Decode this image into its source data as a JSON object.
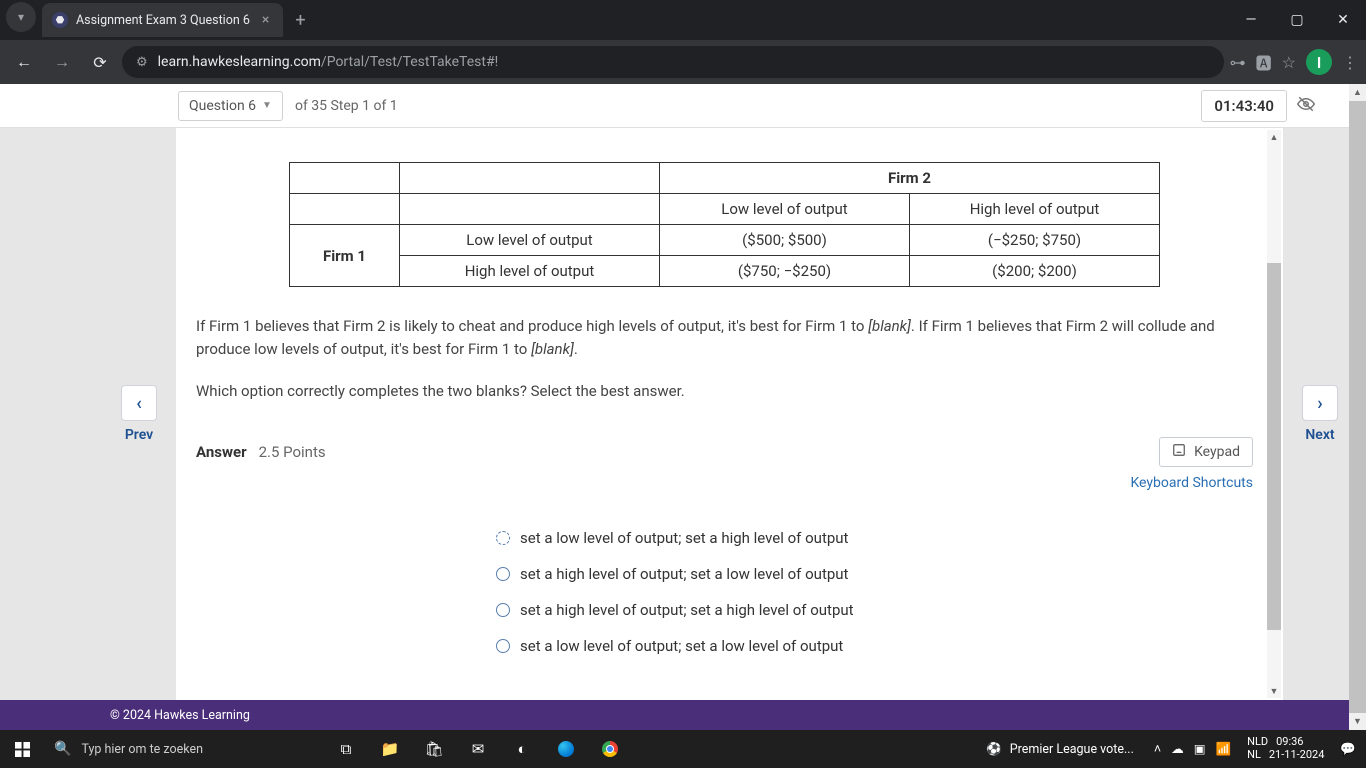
{
  "browser": {
    "tab_title": "Assignment Exam 3 Question 6",
    "url_host": "learn.hawkeslearning.com",
    "url_path": "/Portal/Test/TestTakeTest#!"
  },
  "header": {
    "question_label": "Question 6",
    "step_label": "of 35 Step 1 of 1",
    "timer": "01:43:40"
  },
  "nav": {
    "prev": "Prev",
    "next": "Next"
  },
  "table": {
    "firm2_header": "Firm 2",
    "col_low": "Low level of output",
    "col_high": "High level of output",
    "firm1_header": "Firm 1",
    "row_low": "Low level of output",
    "row_high": "High level of output",
    "cells": {
      "ll": "($500; $500)",
      "lh": "(−$250; $750)",
      "hl": "($750; −$250)",
      "hh": "($200; $200)"
    }
  },
  "question": {
    "p1a": "If Firm 1 believes that Firm 2 is likely to cheat and produce high levels of output, it's best for Firm 1 to ",
    "blank": "[blank]",
    "p1b": ". If Firm 1 believes that Firm 2 will collude and produce low levels of output, it's best for Firm 1 to ",
    "p1c": ".",
    "p2": "Which option correctly completes the two blanks? Select the best answer."
  },
  "answer": {
    "label": "Answer",
    "points": "2.5 Points",
    "keypad": "Keypad",
    "shortcuts": "Keyboard Shortcuts",
    "options": [
      "set a low level of output; set a high level of output",
      "set a high level of output; set a low level of output",
      "set a high level of output; set a high level of output",
      "set a low level of output; set a low level of output"
    ]
  },
  "footer": {
    "copyright": "© 2024 Hawkes Learning"
  },
  "taskbar": {
    "search_placeholder": "Typ hier om te zoeken",
    "news": "Premier League vote...",
    "lang1": "NLD",
    "lang2": "NL",
    "time": "09:36",
    "date": "21-11-2024"
  },
  "chart_data": {
    "type": "table",
    "title": "Payoff matrix (Firm 1 payoff; Firm 2 payoff)",
    "row_player": "Firm 1",
    "col_player": "Firm 2",
    "row_strategies": [
      "Low level of output",
      "High level of output"
    ],
    "col_strategies": [
      "Low level of output",
      "High level of output"
    ],
    "payoffs": [
      [
        [
          500,
          500
        ],
        [
          -250,
          750
        ]
      ],
      [
        [
          750,
          -250
        ],
        [
          200,
          200
        ]
      ]
    ]
  }
}
